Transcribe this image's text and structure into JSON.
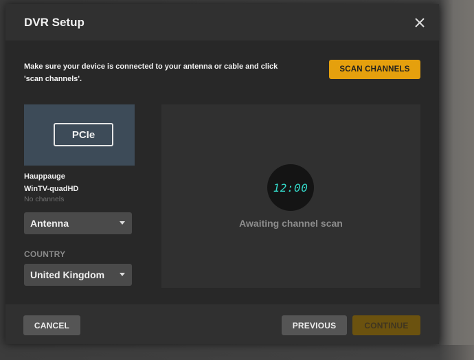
{
  "dialog": {
    "title": "DVR Setup",
    "close_icon": "close-icon"
  },
  "instructions": {
    "line1": "Make sure your device is connected to your antenna or cable and click",
    "line2": "'scan channels'."
  },
  "actions": {
    "scan_label": "SCAN CHANNELS"
  },
  "device": {
    "type_label": "PCIe",
    "name_line1": "Hauppauge",
    "name_line2": "WinTV-quadHD",
    "channels_status": "No channels"
  },
  "source": {
    "selected": "Antenna"
  },
  "country": {
    "label": "COUNTRY",
    "selected": "United Kingdom"
  },
  "scan": {
    "clock_time": "12:00",
    "status": "Awaiting channel scan"
  },
  "footer": {
    "cancel_label": "CANCEL",
    "previous_label": "PREVIOUS",
    "continue_label": "CONTINUE"
  },
  "colors": {
    "accent": "#e5a00d",
    "accent_disabled": "#6b520f",
    "clock_digits": "#33d6c6",
    "device_card": "#3d4b58"
  }
}
